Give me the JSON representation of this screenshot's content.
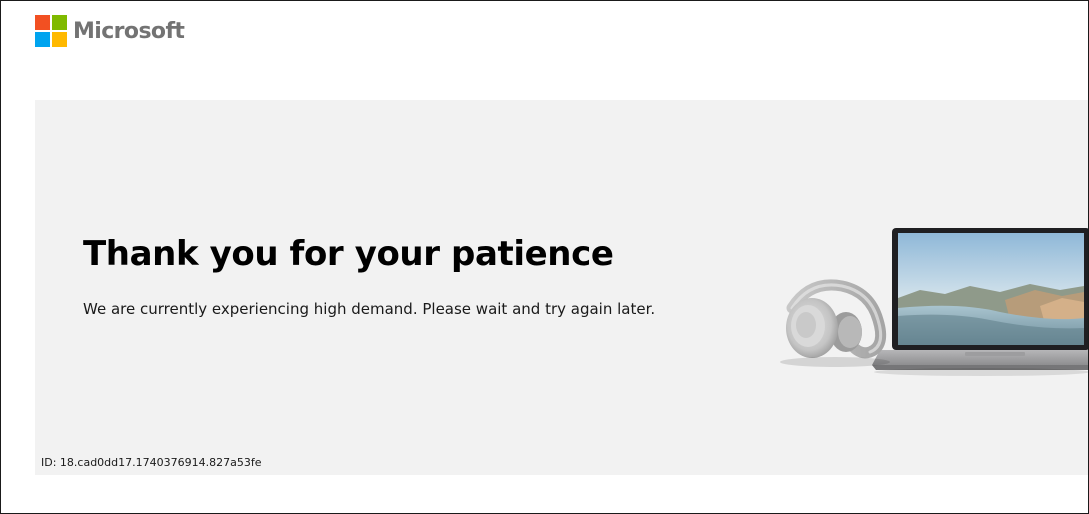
{
  "header": {
    "brand_name": "Microsoft",
    "logo_colors": {
      "red": "#f25022",
      "green": "#7fba00",
      "blue": "#00a4ef",
      "yellow": "#ffb900"
    }
  },
  "main": {
    "title": "Thank you for your patience",
    "message": "We are currently experiencing high demand. Please wait and try again later.",
    "reference_id": "ID: 18.cad0dd17.1740376914.827a53fe",
    "illustration": {
      "items": [
        "headphones-image",
        "laptop-image"
      ]
    }
  },
  "colors": {
    "panel_background": "#f2f2f2",
    "title_text": "#000000",
    "brand_text": "#737373"
  }
}
